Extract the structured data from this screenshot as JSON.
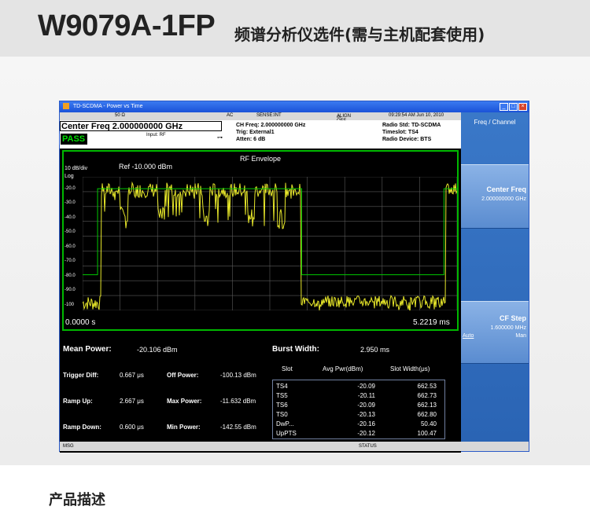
{
  "page": {
    "model": "W9079A-1FP",
    "subtitle": "频谱分析仪选件(需与主机配套使用)",
    "section_heading": "产品描述"
  },
  "window": {
    "title": "TD-SCDMA - Power vs Time",
    "buttons": [
      "_",
      "□",
      "×"
    ]
  },
  "topbar": {
    "impedance": "50 Ω",
    "coupling": "AC",
    "sense": "SENSE:INT",
    "align": "ALIGN OFF",
    "datetime": "09:29:54 AM Jun 10, 2010"
  },
  "header": {
    "center_freq": "Center Freq  2.000000000 GHz",
    "pass": "PASS",
    "input": "Input: RF",
    "ch_freq": "CH Freq: 2.000000000 GHz",
    "trig": "Trig: External1",
    "atten": "Atten: 6 dB",
    "radio_std": "Radio Std: TD-SCDMA",
    "timeslot": "Timeslot: TS4",
    "radio_device": "Radio Device: BTS"
  },
  "plot": {
    "title": "RF Envelope",
    "scale": "10 dB/div",
    "ref": "Ref -10.000 dBm",
    "log": "Log",
    "y_ticks": [
      "-20.0",
      "-30.0",
      "-40.0",
      "-50.0",
      "-60.0",
      "-70.0",
      "-80.0",
      "-90.0",
      "-100"
    ],
    "x_start": "0.0000 s",
    "x_end": "5.2219 ms",
    "trace_color": "#e8e82a",
    "limit_color": "#00c800"
  },
  "results": {
    "mean_power_label": "Mean Power:",
    "mean_power_value": "-20.106 dBm",
    "burst_width_label": "Burst Width:",
    "burst_width_value": "2.950 ms",
    "left": [
      {
        "label": "Trigger Diff:",
        "value": "0.667 μs",
        "label2": "Off Power:",
        "value2": "-100.13 dBm"
      },
      {
        "label": "Ramp Up:",
        "value": "2.667 μs",
        "label2": "Max Power:",
        "value2": "-11.632 dBm"
      },
      {
        "label": "Ramp Down:",
        "value": "0.600 μs",
        "label2": "Min Power:",
        "value2": "-142.55 dBm"
      }
    ],
    "table_headers": [
      "Slot",
      "Avg Pwr(dBm)",
      "Slot Width(μs)"
    ],
    "table_rows": [
      [
        "TS4",
        "-20.09",
        "662.53"
      ],
      [
        "TS5",
        "-20.11",
        "662.73"
      ],
      [
        "TS6",
        "-20.09",
        "662.13"
      ],
      [
        "TS0",
        "-20.13",
        "662.80"
      ],
      [
        "DwP...",
        "-20.16",
        "50.40"
      ],
      [
        "UpPTS",
        "-20.12",
        "100.47"
      ]
    ]
  },
  "statusbar": {
    "msg": "MSG",
    "status": "STATUS"
  },
  "softkeys": {
    "menu": "Freq / Channel",
    "center_freq_label": "Center Freq",
    "center_freq_value": "2.000000000 GHz",
    "cf_step_label": "CF Step",
    "cf_step_value": "1.600000 MHz",
    "auto": "Auto",
    "man": "Man"
  }
}
